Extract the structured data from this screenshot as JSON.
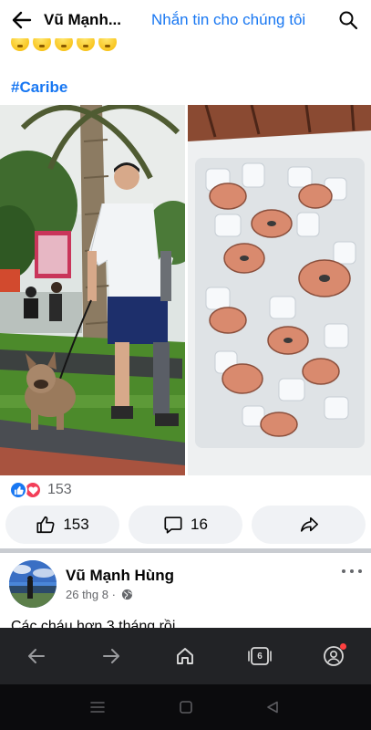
{
  "topbar": {
    "title": "Vũ Mạnh...",
    "message_link": "Nhắn tin cho chúng tôi",
    "back_icon": "arrow-left-icon",
    "search_icon": "search-icon"
  },
  "post": {
    "emoji_icon": "sleepy-face-emoji",
    "emoji_count": 5,
    "hashtag": "#Caribe",
    "photos": [
      {
        "subject": "man-with-french-bulldog-photo"
      },
      {
        "subject": "fish-on-ice-photo"
      }
    ],
    "reaction_count": "153",
    "like_count": "153",
    "comment_count": "16"
  },
  "next_post": {
    "author": "Vũ Mạnh Hùng",
    "date": "26 thg 8 ·",
    "text": "Các cháu hơn 3 tháng rồi",
    "privacy_icon": "globe-icon"
  },
  "browser_bar": {
    "tab_count": "6",
    "icons": [
      "back-icon",
      "forward-icon",
      "home-icon",
      "tabs-icon",
      "account-icon"
    ]
  },
  "system_nav": {
    "icons": [
      "menu-icon",
      "home-square-icon",
      "back-triangle-icon"
    ]
  },
  "colors": {
    "accent": "#1877f2",
    "love": "#f33e58",
    "button_bg": "#f0f2f5",
    "browser_bar": "#222326",
    "notification": "#ff4040"
  }
}
